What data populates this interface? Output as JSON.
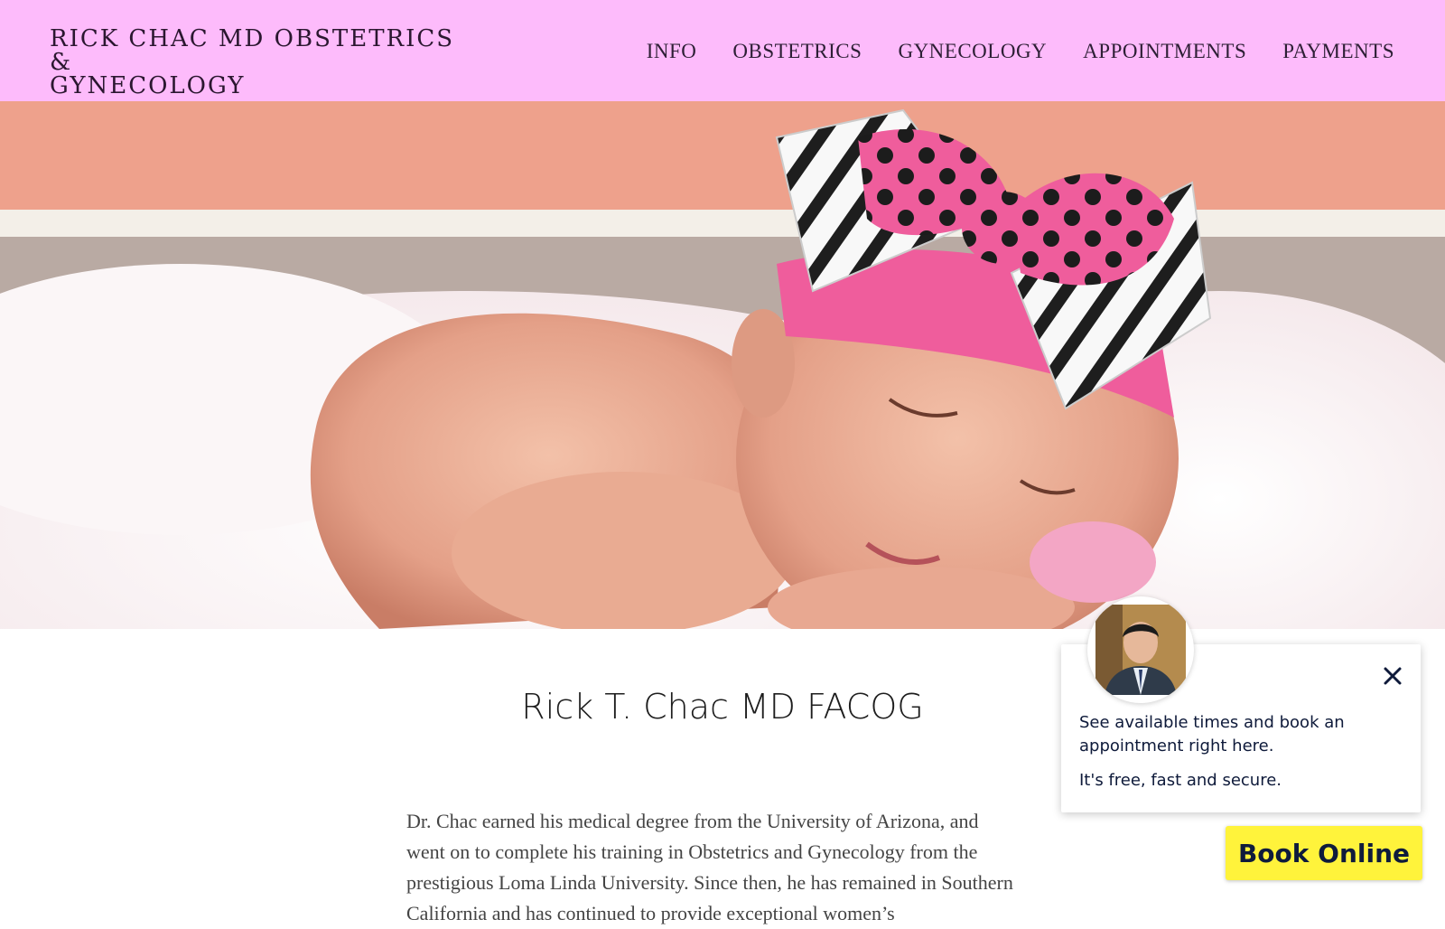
{
  "header": {
    "title_line1": "RICK CHAC MD OBSTETRICS &",
    "title_line2": "GYNECOLOGY",
    "nav": [
      {
        "label": "INFO"
      },
      {
        "label": "OBSTETRICS"
      },
      {
        "label": "GYNECOLOGY"
      },
      {
        "label": "APPOINTMENTS"
      },
      {
        "label": "PAYMENTS"
      }
    ]
  },
  "hero": {
    "image": "sleeping-newborn-with-pink-polka-dot-bow"
  },
  "main": {
    "heading": "Rick T. Chac MD FACOG",
    "bio": "Dr. Chac earned his medical degree from the University of Arizona, and went on to complete his training in Obstetrics and Gynecology from the prestigious Loma Linda University.  Since then, he has remained in Southern California and has continued to provide exceptional women’s"
  },
  "booking_popup": {
    "message": "See available times and book an appointment right here.",
    "tagline": "It's free, fast and secure.",
    "close_icon": "close-icon",
    "avatar": "doctor-photo"
  },
  "book_button": {
    "label": "Book Online"
  },
  "colors": {
    "header_bg": "#fdbbfb",
    "button_bg": "#fff33b",
    "popup_text": "#0e1a3a"
  }
}
